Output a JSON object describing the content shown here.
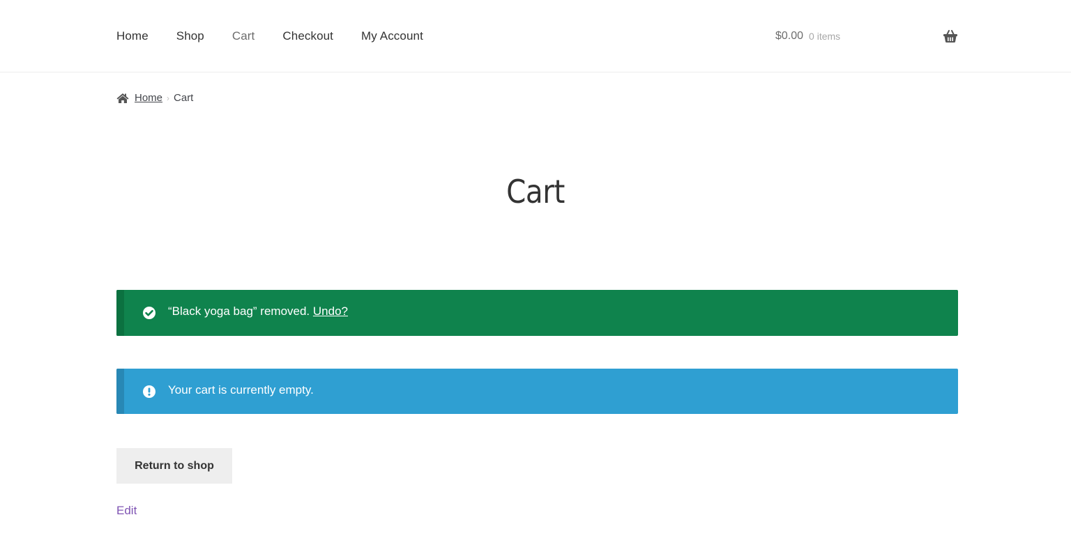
{
  "header": {
    "nav": [
      {
        "label": "Home",
        "current": false
      },
      {
        "label": "Shop",
        "current": false
      },
      {
        "label": "Cart",
        "current": true
      },
      {
        "label": "Checkout",
        "current": false
      },
      {
        "label": "My Account",
        "current": false
      }
    ],
    "cart_amount": "$0.00",
    "cart_count": "0 items",
    "cart_icon": "basket-icon"
  },
  "breadcrumb": {
    "home_icon": "home-icon",
    "home_label": "Home",
    "separator": "›",
    "current": "Cart"
  },
  "page_title": "Cart",
  "notices": {
    "success": {
      "icon": "check-circle-icon",
      "text": "“Black yoga bag” removed. ",
      "link": "Undo?",
      "color": "#0f834d"
    },
    "info": {
      "icon": "exclamation-circle-icon",
      "text": "Your cart is currently empty.",
      "color": "#2f9fd2"
    }
  },
  "actions": {
    "return_to_shop": "Return to shop",
    "edit": "Edit"
  }
}
